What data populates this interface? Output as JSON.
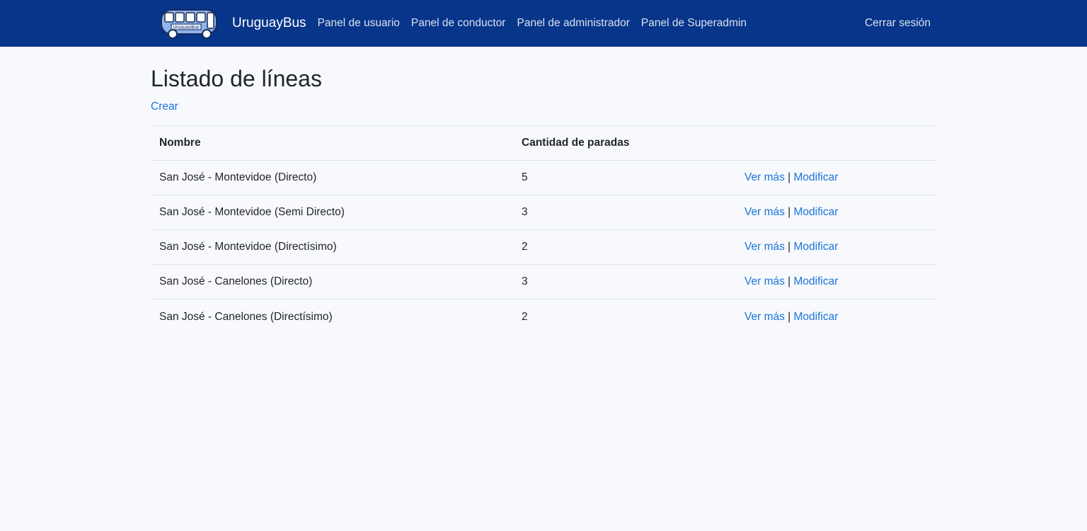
{
  "navbar": {
    "logo_text": "UruguayBus",
    "brand": "UruguayBus",
    "links": [
      {
        "label": "Panel de usuario"
      },
      {
        "label": "Panel de conductor"
      },
      {
        "label": "Panel de administrador"
      },
      {
        "label": "Panel de Superadmin"
      }
    ],
    "logout": "Cerrar sesión"
  },
  "page": {
    "title": "Listado de líneas",
    "create_label": "Crear"
  },
  "table": {
    "headers": [
      "Nombre",
      "Cantidad de paradas",
      ""
    ],
    "rows": [
      {
        "name": "San José - Montevidoe (Directo)",
        "stops": "5",
        "view": "Ver más",
        "sep": "|",
        "edit": "Modificar"
      },
      {
        "name": "San José - Montevidoe (Semi Directo)",
        "stops": "3",
        "view": "Ver más",
        "sep": "|",
        "edit": "Modificar"
      },
      {
        "name": "San José - Montevidoe (Directísimo)",
        "stops": "2",
        "view": "Ver más",
        "sep": "|",
        "edit": "Modificar"
      },
      {
        "name": "San José - Canelones (Directo)",
        "stops": "3",
        "view": "Ver más",
        "sep": "|",
        "edit": "Modificar"
      },
      {
        "name": "San José - Canelones (Directísimo)",
        "stops": "2",
        "view": "Ver más",
        "sep": "|",
        "edit": "Modificar"
      }
    ]
  },
  "colors": {
    "navbar_bg": "#06358a",
    "link": "#1a74d6",
    "page_bg": "#f8f9fd"
  }
}
